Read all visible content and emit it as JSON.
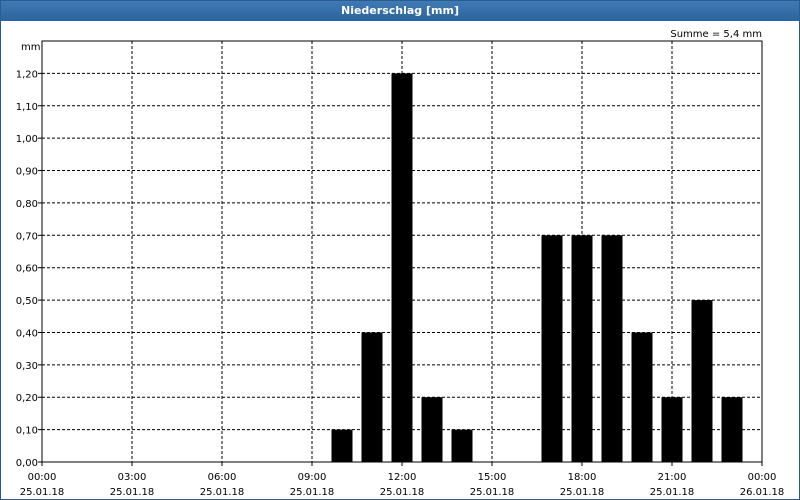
{
  "window": {
    "title": "Niederschlag [mm]"
  },
  "chart_data": {
    "type": "bar",
    "title": "Niederschlag [mm]",
    "ylabel": "mm",
    "annotation": "Summe = 5,4 mm",
    "ylim": [
      0,
      1.3
    ],
    "yticks": [
      "0,00",
      "0,10",
      "0,20",
      "0,30",
      "0,40",
      "0,50",
      "0,60",
      "0,70",
      "0,80",
      "0,90",
      "1,00",
      "1,10",
      "1,20"
    ],
    "xlim_hours": [
      0,
      24
    ],
    "xticks": [
      {
        "time": "00:00",
        "date": "25.01.18"
      },
      {
        "time": "03:00",
        "date": "25.01.18"
      },
      {
        "time": "06:00",
        "date": "25.01.18"
      },
      {
        "time": "09:00",
        "date": "25.01.18"
      },
      {
        "time": "12:00",
        "date": "25.01.18"
      },
      {
        "time": "15:00",
        "date": "25.01.18"
      },
      {
        "time": "18:00",
        "date": "25.01.18"
      },
      {
        "time": "21:00",
        "date": "25.01.18"
      },
      {
        "time": "00:00",
        "date": "26.01.18"
      }
    ],
    "bars": [
      {
        "hour": 10,
        "value": 0.1
      },
      {
        "hour": 11,
        "value": 0.4
      },
      {
        "hour": 12,
        "value": 1.2
      },
      {
        "hour": 13,
        "value": 0.2
      },
      {
        "hour": 14,
        "value": 0.1
      },
      {
        "hour": 17,
        "value": 0.7
      },
      {
        "hour": 18,
        "value": 0.7
      },
      {
        "hour": 19,
        "value": 0.7
      },
      {
        "hour": 20,
        "value": 0.4
      },
      {
        "hour": 21,
        "value": 0.2
      },
      {
        "hour": 22,
        "value": 0.5
      },
      {
        "hour": 23,
        "value": 0.2
      }
    ],
    "bar_color": "#000000",
    "grid": true
  }
}
